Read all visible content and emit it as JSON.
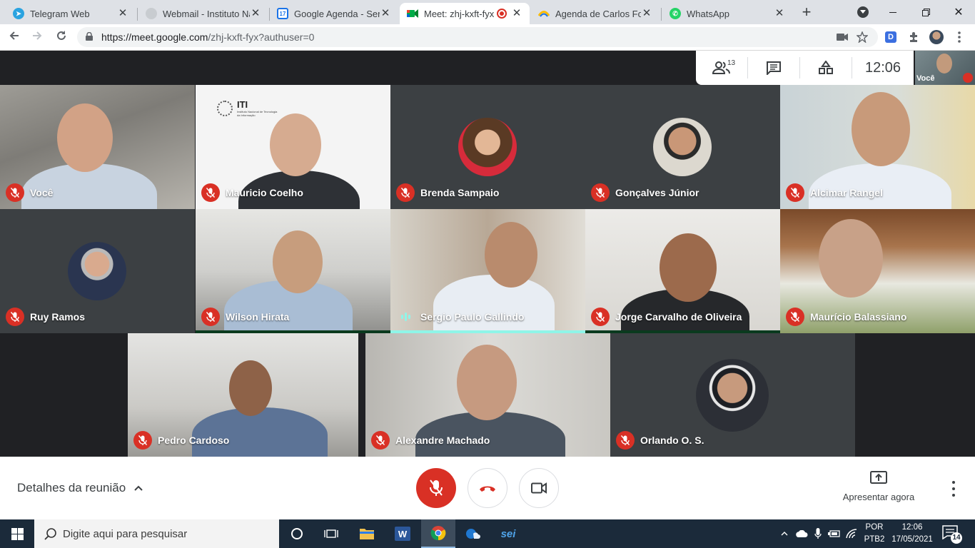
{
  "browser": {
    "tabs": [
      {
        "title": "Telegram Web",
        "icon": "telegram-icon",
        "color": "#2aa3e0"
      },
      {
        "title": "Webmail - Instituto Na",
        "icon": "webmail-icon",
        "color": "#9aa0a6"
      },
      {
        "title": "Google Agenda - Sem",
        "icon": "calendar-icon",
        "color": "#1a73e8"
      },
      {
        "title": "Meet: zhj-kxft-fyx",
        "icon": "meet-icon",
        "color": "#00897b",
        "active": true
      },
      {
        "title": "Agenda de Carlos Fort",
        "icon": "agenda-icon",
        "color": "#fbbc04"
      },
      {
        "title": "WhatsApp",
        "icon": "whatsapp-icon",
        "color": "#25d366"
      }
    ],
    "url_main": "https://meet.google.com",
    "url_rest": "/zhj-kxft-fyx?authuser=0",
    "extension_letter": "D"
  },
  "meet": {
    "participant_count": "13",
    "clock": "12:06",
    "self_label": "Você",
    "participants": [
      {
        "name": "Você"
      },
      {
        "name": "Mauricio Coelho",
        "logo_text": "ITI",
        "logo_sub": "Instituto Nacional de Tecnologia da Informação"
      },
      {
        "name": "Brenda Sampaio"
      },
      {
        "name": "Gonçalves Júnior"
      },
      {
        "name": "Alcimar Rangel"
      },
      {
        "name": "Ruy Ramos"
      },
      {
        "name": "Wilson Hirata"
      },
      {
        "name": "Sergio Paulo Gallindo",
        "speaking": true
      },
      {
        "name": "Jorge Carvalho de Oliveira"
      },
      {
        "name": "Maurício Balassiano"
      },
      {
        "name": "Pedro Cardoso"
      },
      {
        "name": "Alexandre Machado"
      },
      {
        "name": "Orlando O. S."
      }
    ]
  },
  "controls": {
    "details_label": "Detalhes da reunião",
    "present_label": "Apresentar agora"
  },
  "taskbar": {
    "search_placeholder": "Digite aqui para pesquisar",
    "lang_line1": "POR",
    "lang_line2": "PTB2",
    "time": "12:06",
    "date": "17/05/2021",
    "notification_count": "14",
    "sei_label": "sei"
  }
}
